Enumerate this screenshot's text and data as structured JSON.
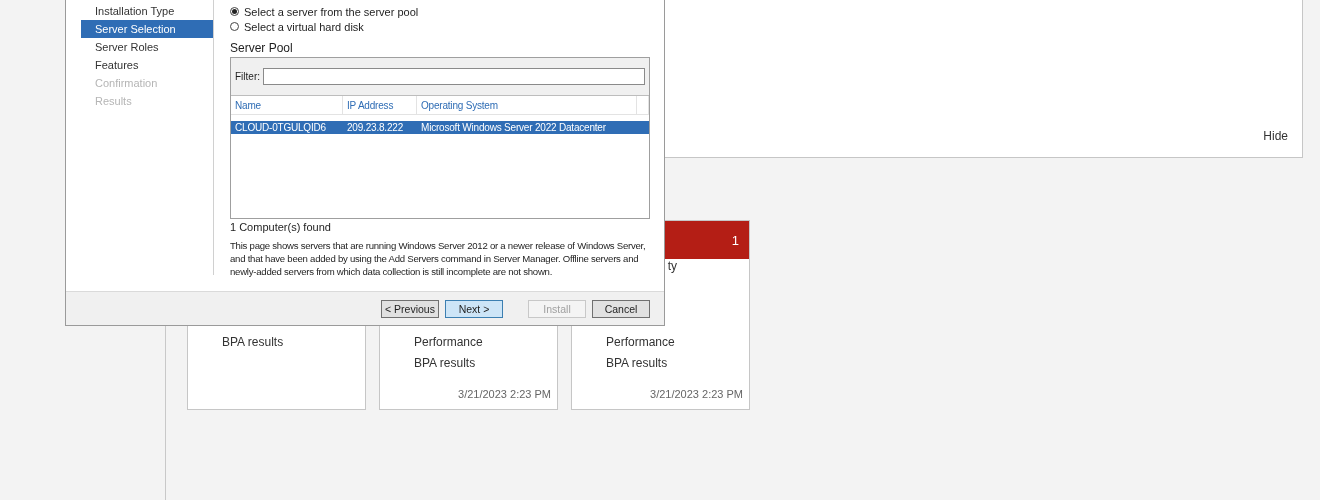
{
  "background": {
    "top_panel": {
      "hide_link": "Hide"
    },
    "tiles": [
      {
        "rows": [
          "BPA results"
        ]
      },
      {
        "rows": [
          "Performance",
          "BPA results"
        ],
        "timestamp": "3/21/2023 2:23 PM"
      },
      {
        "header_count": "1",
        "header_alert": true,
        "cut_row": "ty",
        "rows": [
          "Performance",
          "BPA results"
        ],
        "timestamp": "3/21/2023 2:23 PM"
      }
    ]
  },
  "dialog": {
    "nav": [
      {
        "label": "Installation Type",
        "selected": false,
        "disabled": false
      },
      {
        "label": "Server Selection",
        "selected": true,
        "disabled": false
      },
      {
        "label": "Server Roles",
        "selected": false,
        "disabled": false
      },
      {
        "label": "Features",
        "selected": false,
        "disabled": false
      },
      {
        "label": "Confirmation",
        "selected": false,
        "disabled": true
      },
      {
        "label": "Results",
        "selected": false,
        "disabled": true
      }
    ],
    "options": [
      {
        "label": "Select a server from the server pool",
        "selected": true
      },
      {
        "label": "Select a virtual hard disk",
        "selected": false
      }
    ],
    "pool": {
      "title": "Server Pool",
      "filter_label": "Filter:",
      "columns": [
        "Name",
        "IP Address",
        "Operating System"
      ],
      "rows": [
        {
          "cells": [
            "CLOUD-0TGULQID6",
            "209.23.8.222",
            "Microsoft Windows Server 2022 Datacenter"
          ],
          "selected": true
        }
      ]
    },
    "count": "1 Computer(s) found",
    "description": "This page shows servers that are running Windows Server 2012 or a newer release of Windows Server, and that have been added by using the Add Servers command in Server Manager. Offline servers and newly-added servers from which data collection is still incomplete are not shown.",
    "buttons": [
      {
        "label": "< Previous",
        "kind": "normal",
        "disabled": false
      },
      {
        "label": "Next >",
        "kind": "default",
        "disabled": false
      },
      {
        "label": "Install",
        "kind": "gap",
        "disabled": true
      },
      {
        "label": "Cancel",
        "kind": "normal",
        "disabled": false
      }
    ]
  }
}
